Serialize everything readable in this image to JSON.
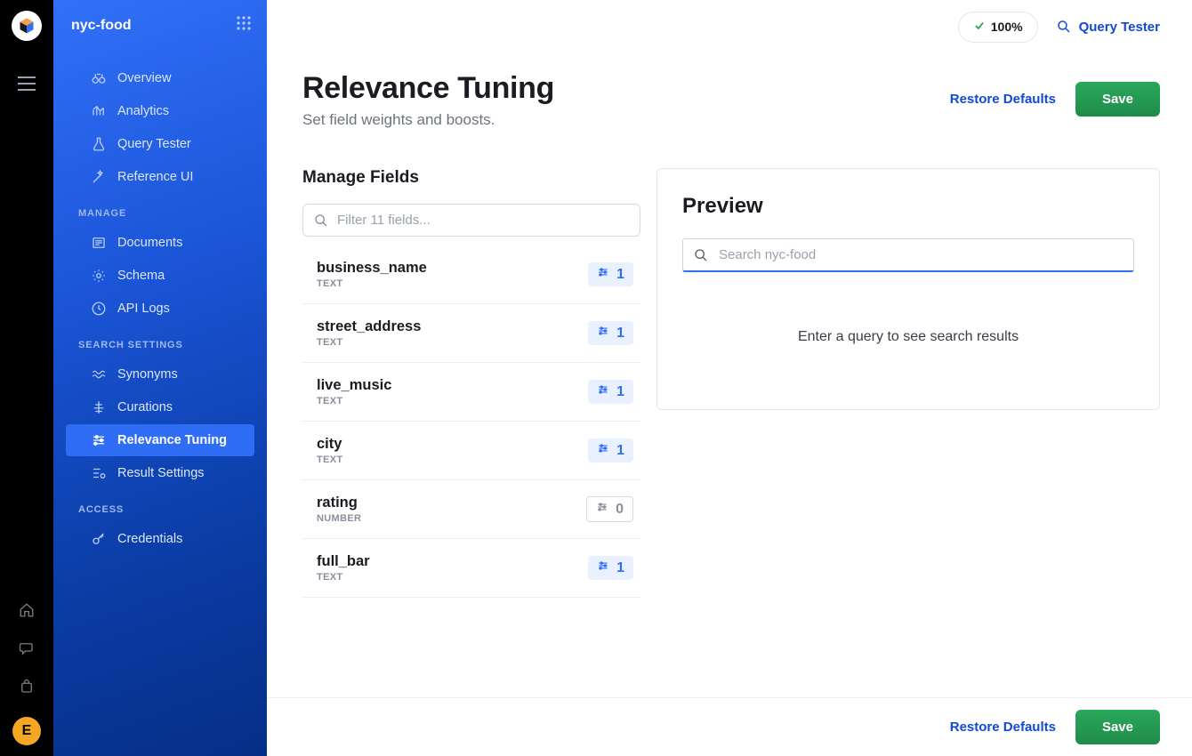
{
  "workspace": {
    "name": "nyc-food"
  },
  "avatar": {
    "initial": "E"
  },
  "topbar": {
    "health_percent": "100%",
    "query_tester_label": "Query Tester"
  },
  "page": {
    "title": "Relevance Tuning",
    "subtitle": "Set field weights and boosts.",
    "restore_defaults": "Restore Defaults",
    "save": "Save"
  },
  "nav": {
    "sections": [
      {
        "label": null,
        "items": [
          {
            "id": "overview",
            "label": "Overview",
            "icon": "binoculars"
          },
          {
            "id": "analytics",
            "label": "Analytics",
            "icon": "analytics"
          },
          {
            "id": "query-tester",
            "label": "Query Tester",
            "icon": "flask"
          },
          {
            "id": "reference-ui",
            "label": "Reference UI",
            "icon": "wand"
          }
        ]
      },
      {
        "label": "MANAGE",
        "items": [
          {
            "id": "documents",
            "label": "Documents",
            "icon": "document"
          },
          {
            "id": "schema",
            "label": "Schema",
            "icon": "gear"
          },
          {
            "id": "api-logs",
            "label": "API Logs",
            "icon": "clock"
          }
        ]
      },
      {
        "label": "SEARCH SETTINGS",
        "items": [
          {
            "id": "synonyms",
            "label": "Synonyms",
            "icon": "waves"
          },
          {
            "id": "curations",
            "label": "Curations",
            "icon": "curations"
          },
          {
            "id": "relevance-tuning",
            "label": "Relevance Tuning",
            "icon": "sliders",
            "active": true
          },
          {
            "id": "result-settings",
            "label": "Result Settings",
            "icon": "list-gear"
          }
        ]
      },
      {
        "label": "ACCESS",
        "items": [
          {
            "id": "credentials",
            "label": "Credentials",
            "icon": "key"
          }
        ]
      }
    ]
  },
  "manage_fields": {
    "title": "Manage Fields",
    "filter_placeholder": "Filter 11 fields...",
    "fields": [
      {
        "name": "business_name",
        "type": "TEXT",
        "weight": "1",
        "enabled": true
      },
      {
        "name": "street_address",
        "type": "TEXT",
        "weight": "1",
        "enabled": true
      },
      {
        "name": "live_music",
        "type": "TEXT",
        "weight": "1",
        "enabled": true
      },
      {
        "name": "city",
        "type": "TEXT",
        "weight": "1",
        "enabled": true
      },
      {
        "name": "rating",
        "type": "NUMBER",
        "weight": "0",
        "enabled": false
      },
      {
        "name": "full_bar",
        "type": "TEXT",
        "weight": "1",
        "enabled": true
      }
    ]
  },
  "preview": {
    "title": "Preview",
    "search_placeholder": "Search nyc-food",
    "empty_message": "Enter a query to see search results"
  }
}
